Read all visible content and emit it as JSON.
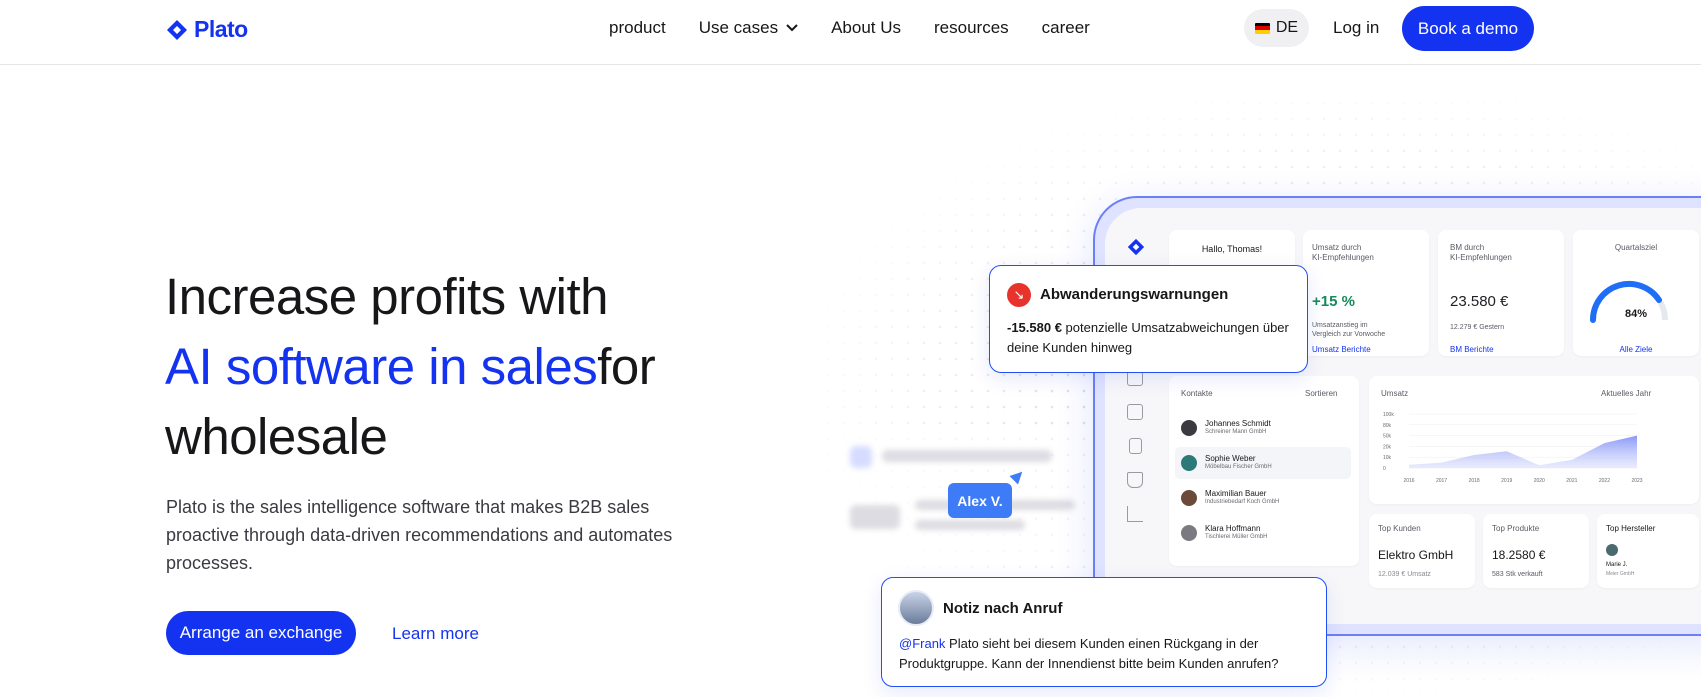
{
  "brand": {
    "name": "Plato",
    "accent": "#1433f0"
  },
  "nav": {
    "links": [
      {
        "label": "product"
      },
      {
        "label": "Use cases"
      },
      {
        "label": "About Us"
      },
      {
        "label": "resources"
      },
      {
        "label": "career"
      }
    ],
    "lang": "DE",
    "login": "Log in",
    "demo": "Book a demo"
  },
  "hero": {
    "title_line1": "Increase profits with",
    "title_highlight": "AI software in sales",
    "title_rest": "for",
    "title_line3": "wholesale",
    "subtitle": "Plato is the sales intelligence software that makes B2B sales proactive through data-driven recommendations and automates processes.",
    "cta": "Arrange an exchange",
    "learn_more": "Learn more"
  },
  "dashboard": {
    "greeting": "Hallo, Thomas!",
    "kpi1": {
      "title1": "Umsatz durch",
      "title2": "KI-Empfehlungen",
      "value": "+15 %",
      "desc1": "Umsatzanstieg im",
      "desc2": "Vergleich zur Vorwoche",
      "link": "Umsatz Berichte"
    },
    "kpi2": {
      "title1": "BM durch",
      "title2": "KI-Empfehlungen",
      "value": "23.580 €",
      "desc": "12.279 € Gestern",
      "link": "BM Berichte"
    },
    "kpi3": {
      "title": "Quartalsziel",
      "value": "84%",
      "link": "Alle Ziele"
    },
    "contacts": {
      "title": "Kontakte",
      "sort": "Sortieren",
      "items": [
        {
          "name": "Johannes Schmidt",
          "company": "Schreiner Mann GmbH"
        },
        {
          "name": "Sophie Weber",
          "company": "Möbelbau Fischer GmbH"
        },
        {
          "name": "Maximilian Bauer",
          "company": "Industriebedarf Koch GmbH"
        },
        {
          "name": "Klara Hoffmann",
          "company": "Tischlerei Müller GmbH"
        }
      ]
    },
    "revenue": {
      "title": "Umsatz",
      "period": "Aktuelles Jahr"
    },
    "top_customers": {
      "title": "Top Kunden",
      "value": "Elektro GmbH",
      "desc": "12.039 € Umsatz"
    },
    "top_products": {
      "title": "Top Produkte",
      "value": "18.2580 €",
      "desc": "583 Stk verkauft"
    },
    "top_makers": {
      "title": "Top Hersteller",
      "name": "Marie J.",
      "company": "Meier GmbH"
    }
  },
  "chart_data": {
    "type": "area",
    "x": [
      "2016",
      "2017",
      "2018",
      "2019",
      "2020",
      "2021",
      "2022",
      "2023"
    ],
    "yticks": [
      "100k",
      "80k",
      "50k",
      "20k",
      "10k",
      "0"
    ],
    "values": [
      6,
      10,
      24,
      31,
      5,
      15,
      46,
      60
    ]
  },
  "warning": {
    "title": "Abwanderungswarnungen",
    "amount": "-15.580 €",
    "text": " potenzielle Umsatzabweichungen über deine Kunden hinweg"
  },
  "note": {
    "title": "Notiz nach Anruf",
    "mention": "@Frank",
    "text": " Plato sieht bei diesem Kunden einen Rückgang in der Produktgruppe. Kann der Innendienst bitte beim Kunden anrufen?"
  },
  "cursor_label": "Alex V."
}
